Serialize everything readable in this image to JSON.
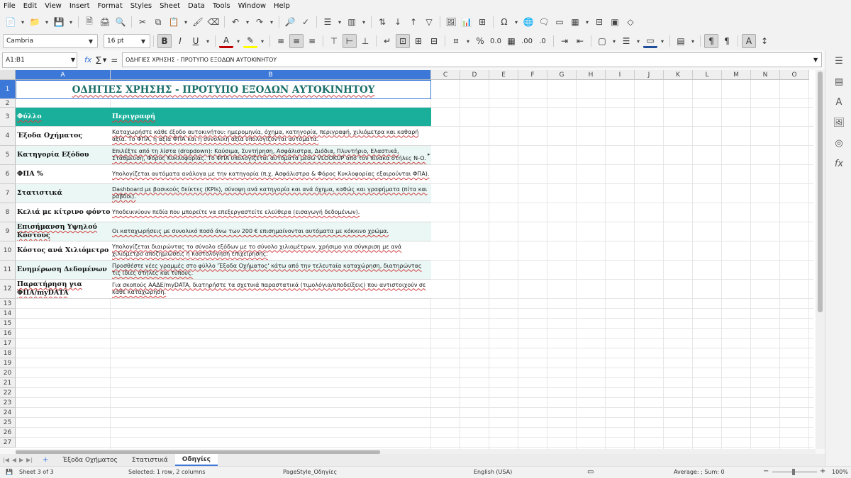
{
  "menu": [
    "File",
    "Edit",
    "View",
    "Insert",
    "Format",
    "Styles",
    "Sheet",
    "Data",
    "Tools",
    "Window",
    "Help"
  ],
  "toolbar": {
    "font_name": "Cambria",
    "font_size": "16 pt"
  },
  "formula_bar": {
    "name_box": "A1:B1",
    "fx": "fx",
    "sum": "∑",
    "equals": "=",
    "content": "ΟΔΗΓΙΕΣ ΧΡΗΣΗΣ - ΠΡΟΤΥΠΟ ΕΞΟΔΩΝ ΑΥΤΟΚΙΝΗΤΟΥ"
  },
  "columns": [
    "A",
    "B",
    "C",
    "D",
    "E",
    "F",
    "G",
    "H",
    "I",
    "J",
    "K",
    "L",
    "M",
    "N",
    "O"
  ],
  "rows_numbers": [
    "1",
    "2",
    "3",
    "4",
    "5",
    "6",
    "7",
    "8",
    "9",
    "10",
    "11",
    "12",
    "13",
    "14",
    "15",
    "16",
    "17",
    "18",
    "19",
    "20",
    "21",
    "22",
    "23",
    "24",
    "25",
    "26",
    "27"
  ],
  "sheet": {
    "title": "ΟΔΗΓΙΕΣ ΧΡΗΣΗΣ - ΠΡΟΤΥΠΟ ΕΞΟΔΩΝ ΑΥΤΟΚΙΝΗΤΟΥ",
    "header": {
      "a": "Φύλλο",
      "b": "Περιγραφή"
    },
    "rows": [
      {
        "a": "Έξοδα Οχήματος",
        "b": "Καταχωρήστε κάθε έξοδο αυτοκινήτου: ημερομηνία, όχημα, κατηγορία, περιγραφή, χιλιόμετρα και καθαρή αξία. Το ΦΠΑ, η αξία ΦΠΑ και η συνολική αξία υπολογίζονται αυτόματα."
      },
      {
        "a": "Κατηγορία Εξόδου",
        "b": "Επιλέξτε από τη λίστα (dropdown): Καύσιμα, Συντήρηση, Ασφάλιστρα, Διόδια, Πλυντήριο, Ελαστικά, Στάθμευση, Φόρος Κυκλοφορίας. Το ΦΠΑ υπολογίζεται αυτόματα μέσω VLOOKUP από τον πίνακα στήλες N-O."
      },
      {
        "a": "ΦΠΑ %",
        "b": "Υπολογίζεται αυτόματα ανάλογα με την κατηγορία (π.χ. Ασφάλιστρα & Φόρος Κυκλοφορίας εξαιρούνται ΦΠΑ)."
      },
      {
        "a": "Στατιστικά",
        "b": "Dashboard με βασικούς δείκτες (KPIs), σύνοψη ανά κατηγορία και ανά όχημα, καθώς και γραφήματα (πίτα και ράβδοι)."
      },
      {
        "a": "Κελιά με κίτρινο φόντο",
        "b": "Υποδεικνύουν πεδία που μπορείτε να επεξεργαστείτε ελεύθερα (εισαγωγή δεδομένων)."
      },
      {
        "a": "Επισήμανση Υψηλού Κόστους",
        "b": "Οι καταχωρήσεις με συνολικό ποσό άνω των 200 € επισημαίνονται αυτόματα με κόκκινο χρώμα."
      },
      {
        "a": "Κόστος ανά Χιλιόμετρο",
        "b": "Υπολογίζεται διαιρώντας το σύνολο εξόδων με το σύνολο χιλιομέτρων, χρήσιμο για σύγκριση με ανά χιλιόμετρο αποζημιώσεις ή κοστολόγηση επιχείρησης."
      },
      {
        "a": "Ενημέρωση Δεδομένων",
        "b": "Προσθέστε νέες γραμμές στο φύλλο 'Έξοδα Οχήματος' κάτω από την τελευταία καταχώρηση, διατηρώντας τις ίδιες στήλες και τύπους."
      },
      {
        "a": "Παρατήρηση για ΦΠΑ/myDATA",
        "b": "Για σκοπούς ΑΑΔΕ/myDATA, διατηρήστε τα σχετικά παραστατικά (τιμολόγια/αποδείξεις) που αντιστοιχούν σε κάθε καταχώρηση."
      }
    ]
  },
  "tabs": {
    "add": "+",
    "items": [
      "Έξοδα Οχήματος",
      "Στατιστικά",
      "Οδηγίες"
    ],
    "active": 2
  },
  "status": {
    "sheet": "Sheet 3 of 3",
    "selection": "Selected: 1 row, 2 columns",
    "page_style": "PageStyle_Οδηγίες",
    "language": "English (USA)",
    "stats": "Average: ; Sum: 0",
    "zoom": "100%"
  },
  "colors": {
    "header_fill": "#1aaf9a",
    "alt_row_fill": "#eaf7f5",
    "title_color": "#1a6e6a",
    "selection": "#3b78d8"
  }
}
